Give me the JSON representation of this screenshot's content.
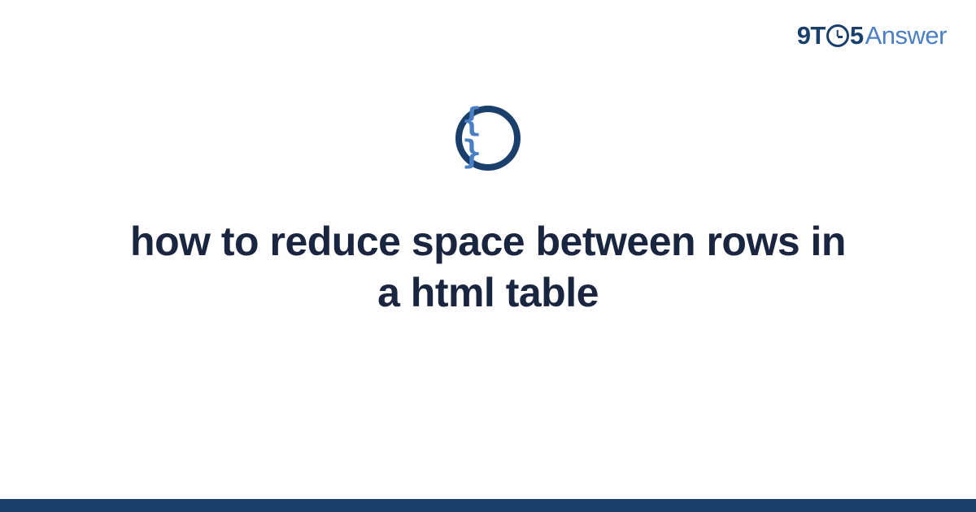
{
  "logo": {
    "prefix": "9T",
    "suffix": "5",
    "word": "Answer"
  },
  "icon": {
    "name": "code-braces-icon",
    "glyph": "{ }"
  },
  "title": "how to reduce space between rows in a html table",
  "colors": {
    "dark_blue": "#1a3f6b",
    "light_blue": "#4a7fc4",
    "text_dark": "#1a2540"
  }
}
